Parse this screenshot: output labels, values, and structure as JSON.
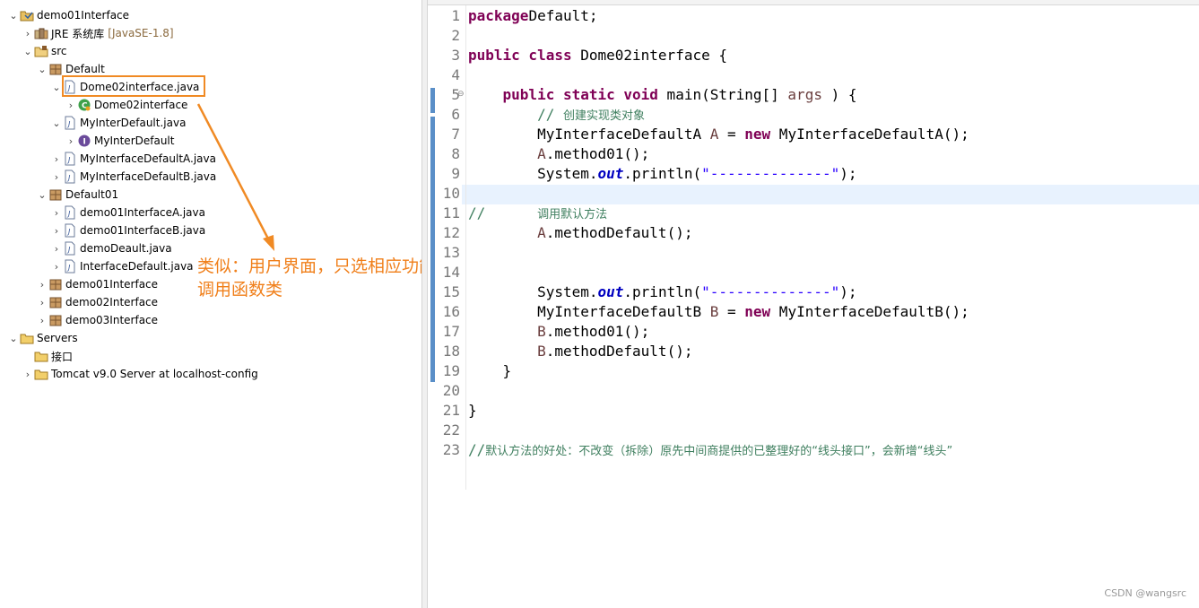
{
  "explorer": {
    "items": [
      {
        "label": "demo01Interface",
        "depth": 0,
        "twisty": "open",
        "icon": "project-icon"
      },
      {
        "label": "JRE 系统库",
        "decoration": "[JavaSE-1.8]",
        "depth": 1,
        "twisty": "closed",
        "icon": "library-icon"
      },
      {
        "label": "src",
        "depth": 1,
        "twisty": "open",
        "icon": "source-folder-icon"
      },
      {
        "label": "Default",
        "depth": 2,
        "twisty": "open",
        "icon": "package-icon"
      },
      {
        "label": "Dome02interface.java",
        "depth": 3,
        "twisty": "open",
        "icon": "java-file-icon",
        "highlighted": true
      },
      {
        "label": "Dome02interface",
        "depth": 4,
        "twisty": "closed",
        "icon": "class-icon"
      },
      {
        "label": "MyInterDefault.java",
        "depth": 3,
        "twisty": "open",
        "icon": "java-file-icon"
      },
      {
        "label": "MyInterDefault",
        "depth": 4,
        "twisty": "closed",
        "icon": "interface-icon"
      },
      {
        "label": "MyInterfaceDefaultA.java",
        "depth": 3,
        "twisty": "closed",
        "icon": "java-file-icon"
      },
      {
        "label": "MyInterfaceDefaultB.java",
        "depth": 3,
        "twisty": "closed",
        "icon": "java-file-icon"
      },
      {
        "label": "Default01",
        "depth": 2,
        "twisty": "open",
        "icon": "package-icon"
      },
      {
        "label": "demo01InterfaceA.java",
        "depth": 3,
        "twisty": "closed",
        "icon": "java-file-icon"
      },
      {
        "label": "demo01InterfaceB.java",
        "depth": 3,
        "twisty": "closed",
        "icon": "java-file-icon"
      },
      {
        "label": "demoDeault.java",
        "depth": 3,
        "twisty": "closed",
        "icon": "java-file-icon"
      },
      {
        "label": "InterfaceDefault.java",
        "depth": 3,
        "twisty": "closed",
        "icon": "java-file-icon"
      },
      {
        "label": "demo01Interface",
        "depth": 2,
        "twisty": "closed",
        "icon": "package-icon"
      },
      {
        "label": "demo02Interface",
        "depth": 2,
        "twisty": "closed",
        "icon": "package-icon"
      },
      {
        "label": "demo03Interface",
        "depth": 2,
        "twisty": "closed",
        "icon": "package-icon"
      },
      {
        "label": "Servers",
        "depth": 0,
        "twisty": "open",
        "icon": "folder-icon"
      },
      {
        "label": "接口",
        "depth": 1,
        "twisty": "none",
        "icon": "folder-icon"
      },
      {
        "label": "Tomcat v9.0 Server at localhost-config",
        "depth": 1,
        "twisty": "closed",
        "icon": "folder-icon"
      }
    ]
  },
  "annotation": {
    "line1": "类似：用户界面，只选相应功能函数",
    "line2": "调用函数类",
    "color": "#f08a24"
  },
  "editor": {
    "lines": [
      {
        "n": "1",
        "segs": [
          [
            "kw",
            "package"
          ],
          [
            "",
            "Default;"
          ]
        ]
      },
      {
        "n": "2",
        "segs": []
      },
      {
        "n": "3",
        "segs": [
          [
            "kw",
            "public class"
          ],
          [
            "",
            " Dome02interface {"
          ]
        ]
      },
      {
        "n": "4",
        "segs": []
      },
      {
        "n": "5",
        "fold": true,
        "segs": [
          [
            "",
            "    "
          ],
          [
            "kw",
            "public static void"
          ],
          [
            "",
            " main(String[] "
          ],
          [
            "var",
            "args"
          ],
          [
            "",
            " ) {"
          ]
        ]
      },
      {
        "n": "6",
        "segs": [
          [
            "",
            "        "
          ],
          [
            "cmt",
            "// "
          ],
          [
            "cmt cmt-cjk",
            "创建实现类对象"
          ]
        ]
      },
      {
        "n": "7",
        "segs": [
          [
            "",
            "        MyInterfaceDefaultA "
          ],
          [
            "var",
            "A"
          ],
          [
            "",
            " = "
          ],
          [
            "kw",
            "new"
          ],
          [
            "",
            " MyInterfaceDefaultA();"
          ]
        ]
      },
      {
        "n": "8",
        "segs": [
          [
            "",
            "        "
          ],
          [
            "var",
            "A"
          ],
          [
            "",
            ".method01();"
          ]
        ]
      },
      {
        "n": "9",
        "segs": [
          [
            "",
            "        System."
          ],
          [
            "fld",
            "out"
          ],
          [
            "",
            ".println("
          ],
          [
            "str",
            "\"--------------\""
          ],
          [
            "",
            ");"
          ]
        ]
      },
      {
        "n": "10",
        "segs": []
      },
      {
        "n": "11",
        "segs": [
          [
            "cmt",
            "//      "
          ],
          [
            "cmt cmt-cjk",
            "调用默认方法"
          ]
        ]
      },
      {
        "n": "12",
        "segs": [
          [
            "",
            "        "
          ],
          [
            "var",
            "A"
          ],
          [
            "",
            ".methodDefault();"
          ]
        ]
      },
      {
        "n": "13",
        "segs": []
      },
      {
        "n": "14",
        "segs": []
      },
      {
        "n": "15",
        "segs": [
          [
            "",
            "        System."
          ],
          [
            "fld",
            "out"
          ],
          [
            "",
            ".println("
          ],
          [
            "str",
            "\"--------------\""
          ],
          [
            "",
            ");"
          ]
        ]
      },
      {
        "n": "16",
        "segs": [
          [
            "",
            "        MyInterfaceDefaultB "
          ],
          [
            "var",
            "B"
          ],
          [
            "",
            " = "
          ],
          [
            "kw",
            "new"
          ],
          [
            "",
            " MyInterfaceDefaultB();"
          ]
        ]
      },
      {
        "n": "17",
        "segs": [
          [
            "",
            "        "
          ],
          [
            "var",
            "B"
          ],
          [
            "",
            ".method01();"
          ]
        ]
      },
      {
        "n": "18",
        "segs": [
          [
            "",
            "        "
          ],
          [
            "var",
            "B"
          ],
          [
            "",
            ".methodDefault();"
          ]
        ]
      },
      {
        "n": "19",
        "segs": [
          [
            "",
            "    }"
          ]
        ]
      },
      {
        "n": "20",
        "segs": []
      },
      {
        "n": "21",
        "segs": [
          [
            "",
            "}"
          ]
        ]
      },
      {
        "n": "22",
        "segs": []
      },
      {
        "n": "23",
        "segs": [
          [
            "cmt",
            "//"
          ],
          [
            "cmt cmt-cjk",
            "默认方法的好处：不改变（拆除）原先中间商提供的已整理好的“线头接口”，会新增“线头”"
          ]
        ]
      }
    ]
  },
  "watermark": "CSDN @wangsrc"
}
